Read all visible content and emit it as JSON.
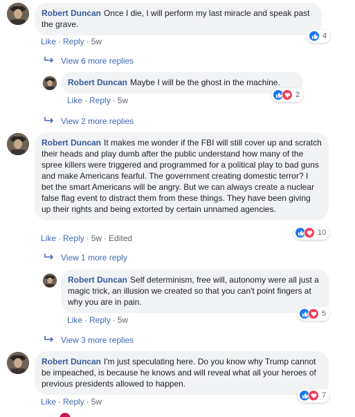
{
  "colors": {
    "link": "#4267b2",
    "name": "#385898",
    "bubble": "#f2f3f5",
    "like": "#1877f2",
    "love": "#f33e58"
  },
  "actions": {
    "like": "Like",
    "reply": "Reply",
    "edited": "Edited"
  },
  "comments": [
    {
      "name": "Robert Duncan",
      "text": "Once I die, I will perform my last miracle and speak past the grave.",
      "time": "5w",
      "reactions": [
        "like-icon"
      ],
      "count": "4"
    },
    {
      "view_more": "View 6 more replies"
    },
    {
      "name": "Robert Duncan",
      "text": "Maybe I will be the ghost in the machine.",
      "time": "5w",
      "reactions": [
        "like-icon",
        "love-icon"
      ],
      "count": "2"
    },
    {
      "view_more": "View 2 more replies"
    },
    {
      "name": "Robert Duncan",
      "text": "It makes me wonder if the FBI will still cover up and scratch their heads and play dumb after the public understand how many of the spree killers were triggered and programmed for a political play to bad guns and make Americans fearful. The government creating domestic terror? I bet the smart Americans will be angry. But we can always create a nuclear false flag event to distract them from these things. They have been giving up their rights and being extorted by certain unnamed agencies.",
      "time": "5w",
      "reactions": [
        "like-icon",
        "love-icon"
      ],
      "count": "10"
    },
    {
      "view_more": "View 1 more reply"
    },
    {
      "name": "Robert Duncan",
      "text": "Self determinism, free will, autonomy were all just a magic trick, an illusion we created so that you can't point fingers at why you are in pain.",
      "time": "5w",
      "reactions": [
        "like-icon",
        "love-icon"
      ],
      "count": "5"
    },
    {
      "view_more": "View 3 more replies"
    },
    {
      "name": "Robert Duncan",
      "text": "I'm just speculating here. Do you know why Trump cannot be impeached, is because he knows and will reveal what all your heroes of previous presidents allowed to happen.",
      "time": "5w",
      "reactions": [
        "like-icon",
        "love-icon"
      ],
      "count": "7"
    }
  ]
}
